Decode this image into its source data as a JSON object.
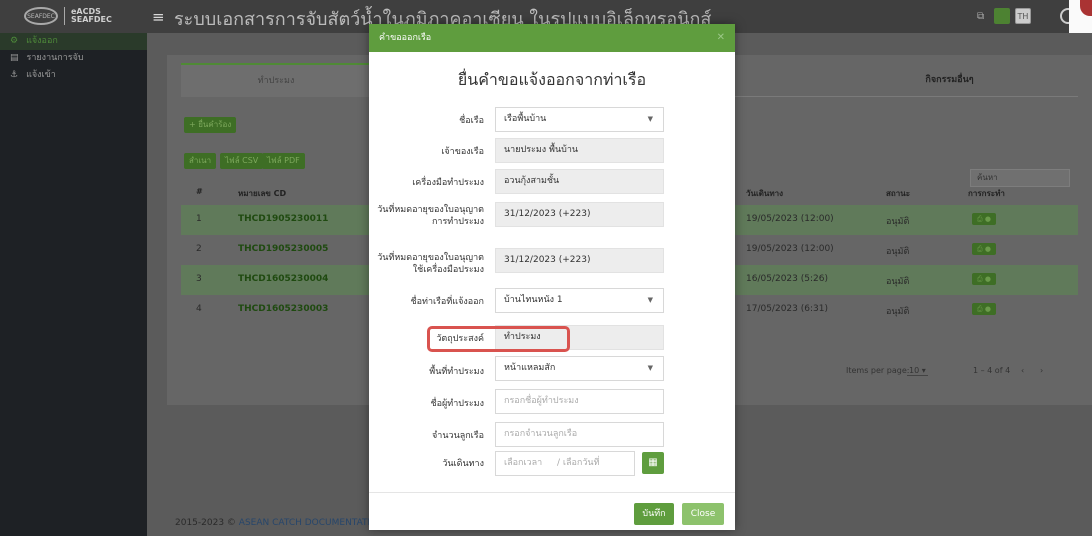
{
  "header": {
    "logo_text_1": "eACDS",
    "logo_text_2": "SEAFDEC",
    "logo_mark": "SEAFDEC",
    "title": "ระบบเอกสารการจับสัตว์น้ำในภูมิภาคอาเซียน ในรูปแบบอิเล็กทรอนิกส์",
    "lang_th": "TH"
  },
  "sidebar": {
    "items": [
      {
        "label": "แจ้งออก",
        "icon": "ship-icon"
      },
      {
        "label": "รายงานการจับ",
        "icon": "document-icon"
      },
      {
        "label": "แจ้งเข้า",
        "icon": "anchor-icon"
      }
    ]
  },
  "main": {
    "tab_active": "ทำประมง",
    "tab_other": "กิจกรรมอื่นๆ",
    "new_request_label": "+ ยื่นคำร้อง",
    "copy_label": "สำเนา",
    "csv_label": "ไฟล์ CSV",
    "pdf_label": "ไฟล์ PDF",
    "search_placeholder": "ค้นหา",
    "columns": {
      "num": "#",
      "cd": "หมายเลข CD",
      "date": "วันเดินทาง",
      "status": "สถานะ",
      "action": "การกระทำ"
    },
    "rows": [
      {
        "num": "1",
        "cd": "THCD1905230011",
        "date": "19/05/2023 (12:00)",
        "status": "อนุมัติ"
      },
      {
        "num": "2",
        "cd": "THCD1905230005",
        "date": "19/05/2023 (12:00)",
        "status": "อนุมัติ"
      },
      {
        "num": "3",
        "cd": "THCD1605230004",
        "date": "16/05/2023 (5:26)",
        "status": "อนุมัติ"
      },
      {
        "num": "4",
        "cd": "THCD1605230003",
        "date": "17/05/2023 (6:31)",
        "status": "อนุมัติ"
      }
    ],
    "items_per_page_label": "Items per page:",
    "items_per_page_value": "10",
    "range_label": "1 – 4 of 4"
  },
  "footer": {
    "year": "2015-2023 ©",
    "org": "ASEAN CATCH DOCUMENTATION S"
  },
  "modal": {
    "header_title": "คำขอออกเรือ",
    "heading": "ยื่นคำขอแจ้งออกจากท่าเรือ",
    "fields": {
      "vessel_label": "ชื่อเรือ",
      "vessel_value": "เรือพื้นบ้าน",
      "owner_label": "เจ้าของเรือ",
      "owner_value": "นายประมง พื้นบ้าน",
      "gear_label": "เครื่องมือทำประมง",
      "gear_value": "อวนกุ้งสามชั้น",
      "license_exp_label": "วันที่หมดอายุของใบอนุญาต การทำประมง",
      "license_exp_value": "31/12/2023 (+223)",
      "gear_license_exp_label": "วันที่หมดอายุของใบอนุญาต ใช้เครื่องมือประมง",
      "gear_license_exp_value": "31/12/2023 (+223)",
      "port_label": "ชื่อท่าเรือที่แจ้งออก",
      "port_value": "บ้านไทนหนัง 1",
      "purpose_label": "วัตถุประสงค์",
      "purpose_value": "ทำประมง",
      "area_label": "พื้นที่ทำประมง",
      "area_value": "หน้าแหลมสัก",
      "captain_label": "ชื่อผู้ทำประมง",
      "captain_placeholder": "กรอกชื่อผู้ทำประมง",
      "crew_label": "จำนวนลูกเรือ",
      "crew_placeholder": "กรอกจำนวนลูกเรือ",
      "depart_label": "วันเดินทาง",
      "time_placeholder": "เลือกเวลา",
      "date_placeholder": "/ เลือกวันที่"
    },
    "save_label": "บันทึก",
    "close_label": "Close"
  },
  "colors": {
    "brand_green": "#5f9d3e",
    "highlight_red": "#d9534f"
  }
}
